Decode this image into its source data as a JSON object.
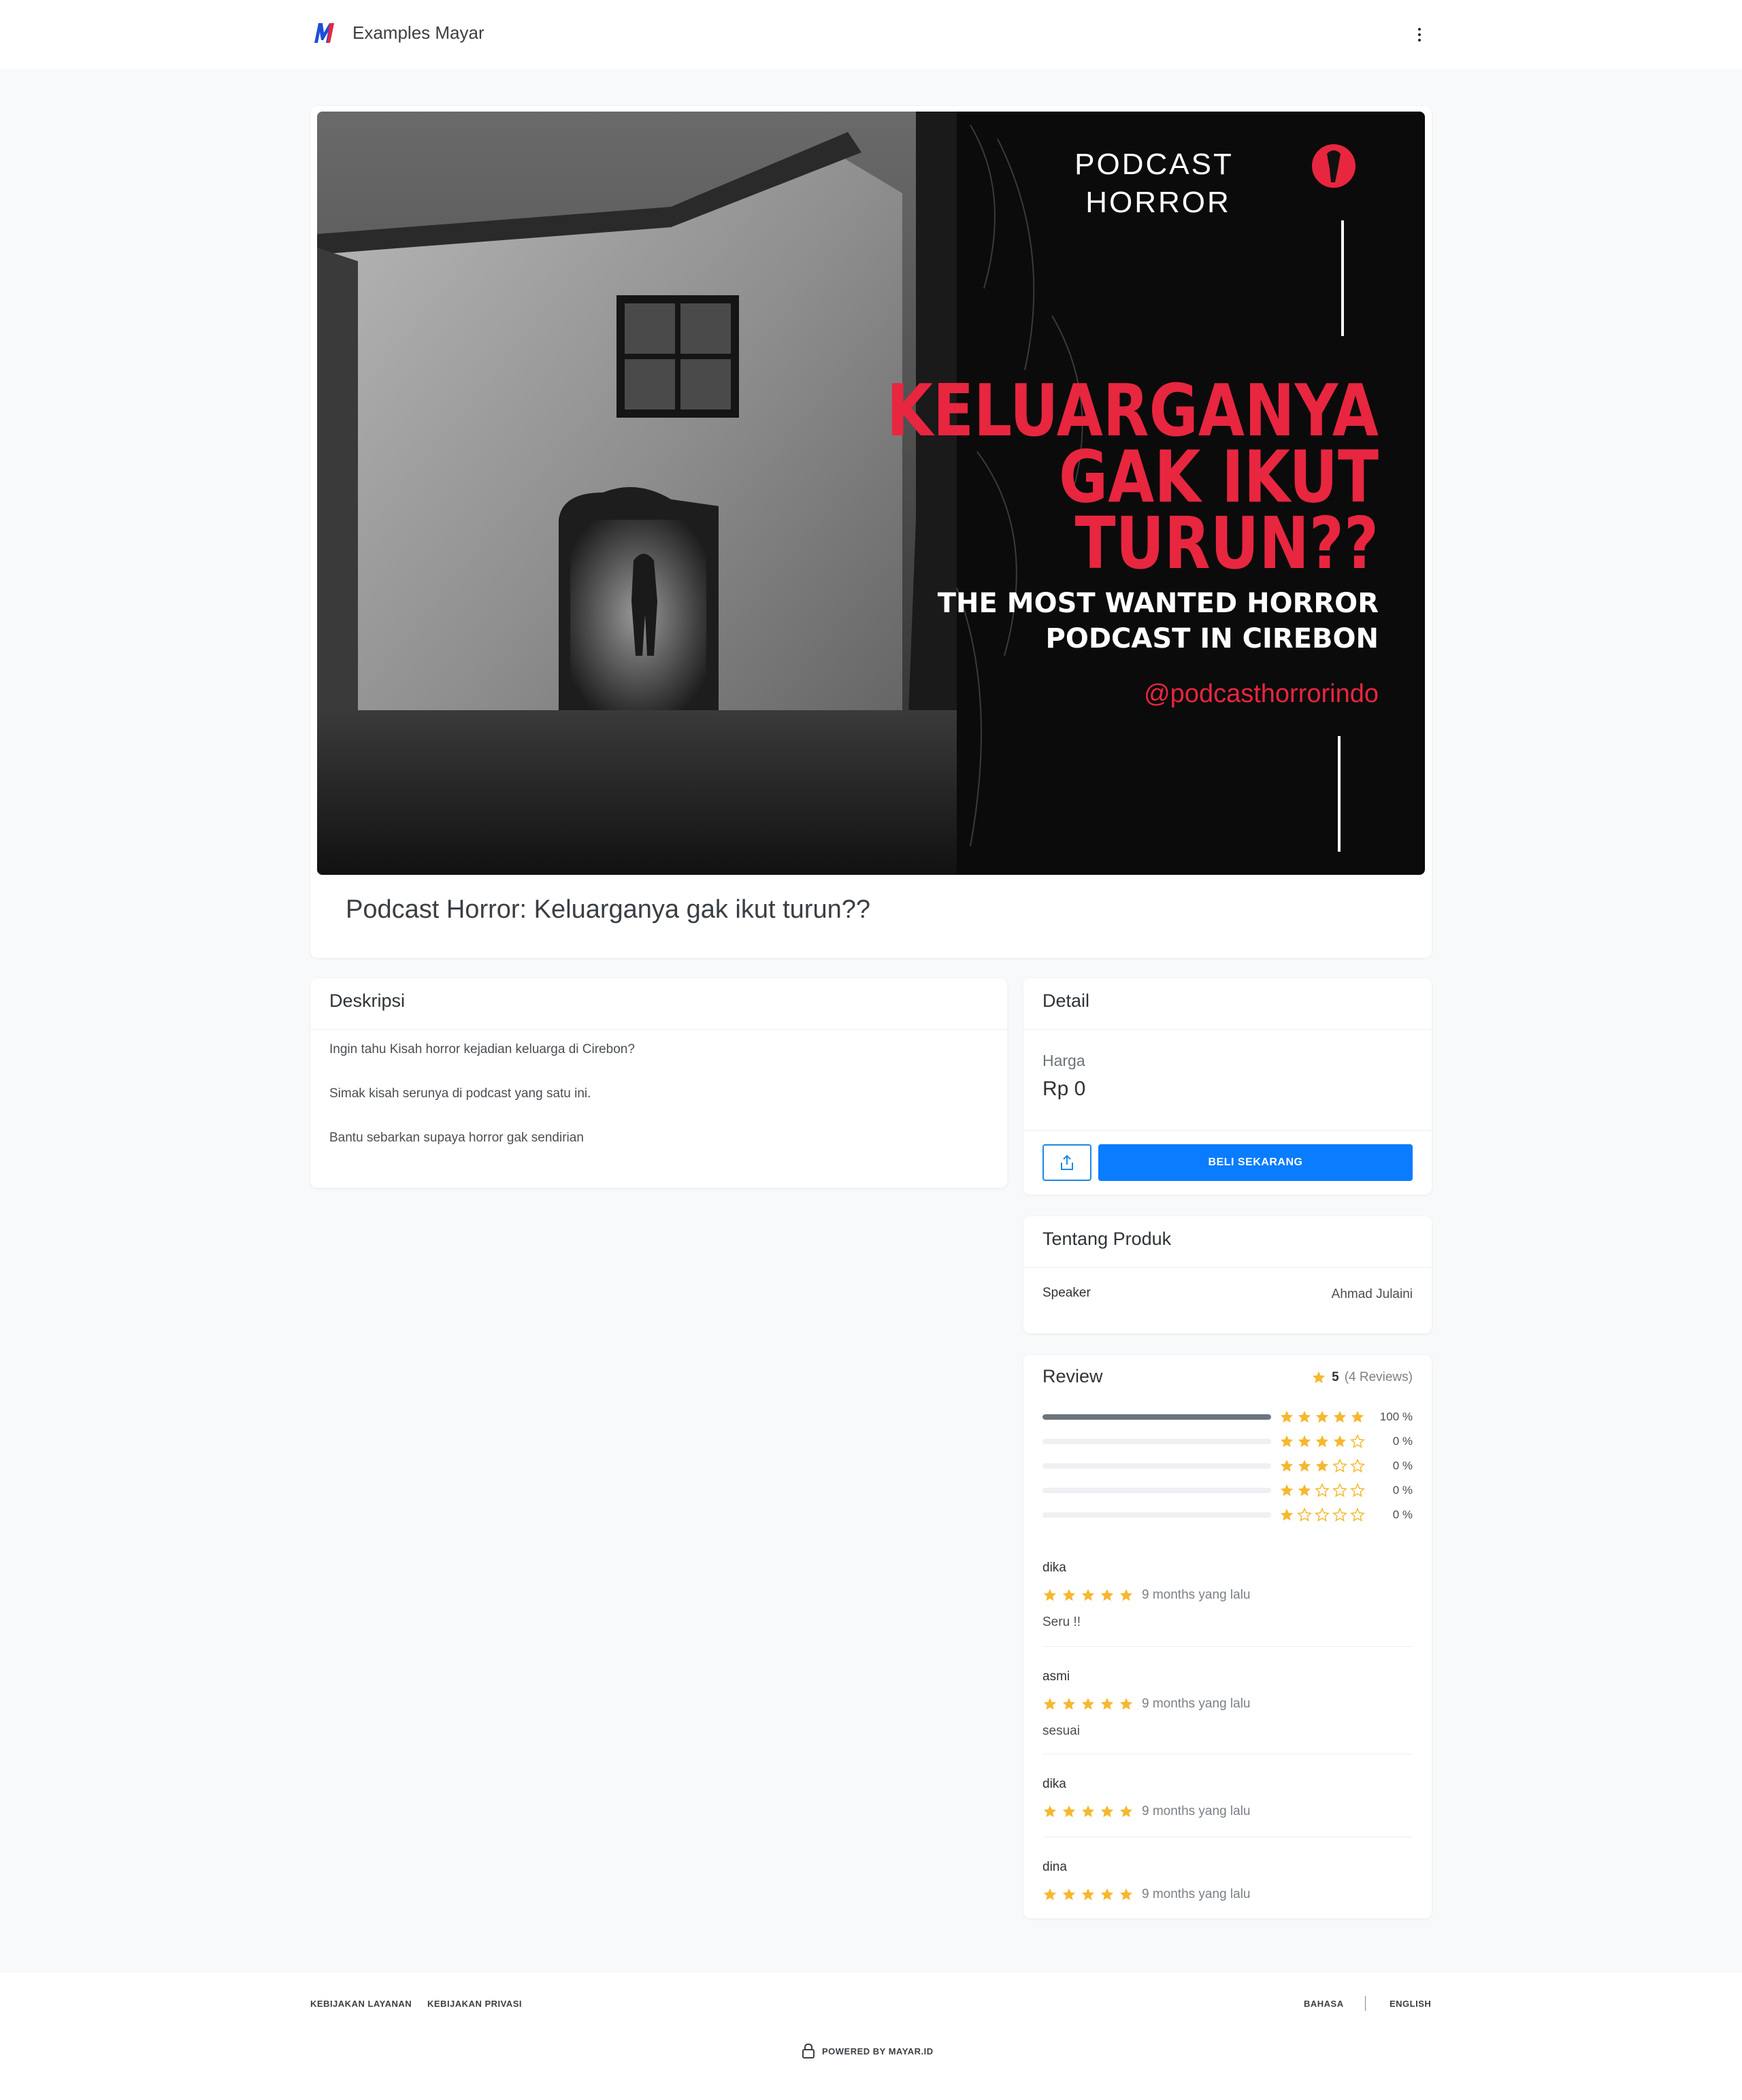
{
  "header": {
    "brand": "Examples Mayar"
  },
  "product": {
    "title": "Podcast Horror: Keluarganya gak ikut turun??",
    "banner": {
      "line1": "PODCAST",
      "line2": "HORROR",
      "headline1": "KELUARGANYA",
      "headline2": "GAK IKUT",
      "headline3": "TURUN??",
      "sub1": "THE MOST WANTED HORROR",
      "sub2": "PODCAST IN CIREBON",
      "handle": "@podcasthorrorindo"
    }
  },
  "description": {
    "heading": "Deskripsi",
    "paragraphs": [
      "Ingin tahu Kisah horror kejadian keluarga di Cirebon?",
      "Simak kisah serunya di podcast yang satu ini.",
      "Bantu sebarkan supaya horror gak sendirian"
    ]
  },
  "detail": {
    "heading": "Detail",
    "price_label": "Harga",
    "price_value": "Rp 0",
    "buy_label": "BELI SEKARANG",
    "share_icon": "share-icon"
  },
  "about": {
    "heading": "Tentang Produk",
    "speaker_label": "Speaker",
    "speaker_value": "Ahmad Julaini"
  },
  "review": {
    "heading": "Review",
    "average": "5",
    "count_text": "(4 Reviews)",
    "distribution": [
      {
        "stars": 5,
        "fraction": 1.0,
        "pct": "100 %"
      },
      {
        "stars": 4,
        "fraction": 0,
        "pct": "0 %"
      },
      {
        "stars": 3,
        "fraction": 0,
        "pct": "0 %"
      },
      {
        "stars": 2,
        "fraction": 0,
        "pct": "0 %"
      },
      {
        "stars": 1,
        "fraction": 0,
        "pct": "0 %"
      }
    ],
    "items": [
      {
        "name": "dika",
        "rating": 5,
        "time": "9 months yang lalu",
        "text": "Seru !!"
      },
      {
        "name": "asmi",
        "rating": 5,
        "time": "9 months yang lalu",
        "text": "sesuai"
      },
      {
        "name": "dika",
        "rating": 5,
        "time": "9 months yang lalu",
        "text": ""
      },
      {
        "name": "dina",
        "rating": 5,
        "time": "9 months yang lalu",
        "text": ""
      }
    ]
  },
  "footer": {
    "terms": "KEBIJAKAN LAYANAN",
    "privacy": "KEBIJAKAN PRIVASI",
    "language_label": "BAHASA",
    "language_value": "ENGLISH",
    "powered": "POWERED BY MAYAR.ID"
  },
  "colors": {
    "primary": "#0a7cff",
    "star": "#f5b82e",
    "headline_red": "#e8263f",
    "bar_fill": "#6c757d"
  }
}
